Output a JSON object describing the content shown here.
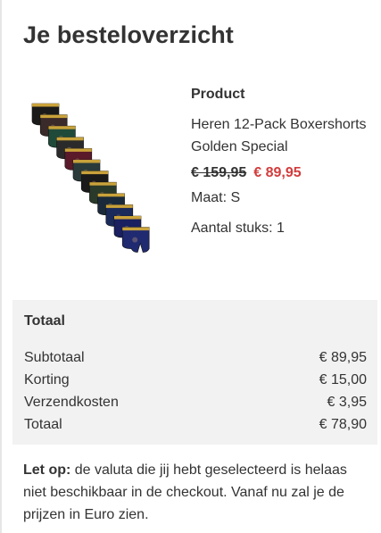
{
  "page": {
    "title": "Je besteloverzicht"
  },
  "product": {
    "heading": "Product",
    "name": "Heren 12-Pack Boxershorts Golden Special",
    "price_old": "€ 159,95",
    "price_new": "€ 89,95",
    "size": "Maat: S",
    "quantity": "Aantal stuks: 1",
    "image_colors": [
      "#1a1a1a",
      "#3a2a2a",
      "#1f4a3a",
      "#2a2a2a",
      "#5a1a2a",
      "#2a3a3a",
      "#1a1a1a",
      "#2a3a2a",
      "#1a2a3a",
      "#1a2a5a",
      "#1a2060",
      "#202a70"
    ],
    "waistband_color": "#c9a23a"
  },
  "totals": {
    "heading": "Totaal",
    "rows": [
      {
        "label": "Subtotaal",
        "value": "€ 89,95"
      },
      {
        "label": "Korting",
        "value": "€ 15,00"
      },
      {
        "label": "Verzendkosten",
        "value": "€ 3,95"
      },
      {
        "label": "Totaal",
        "value": "€ 78,90"
      }
    ]
  },
  "note": {
    "label": "Let op:",
    "text": " de valuta die jij hebt geselecteerd is helaas niet beschikbaar in de checkout. Vanaf nu zal je de prijzen in Euro zien."
  },
  "colors": {
    "sale_red": "#d23c3c",
    "panel_gray": "#f2f2f2",
    "text": "#333333"
  }
}
